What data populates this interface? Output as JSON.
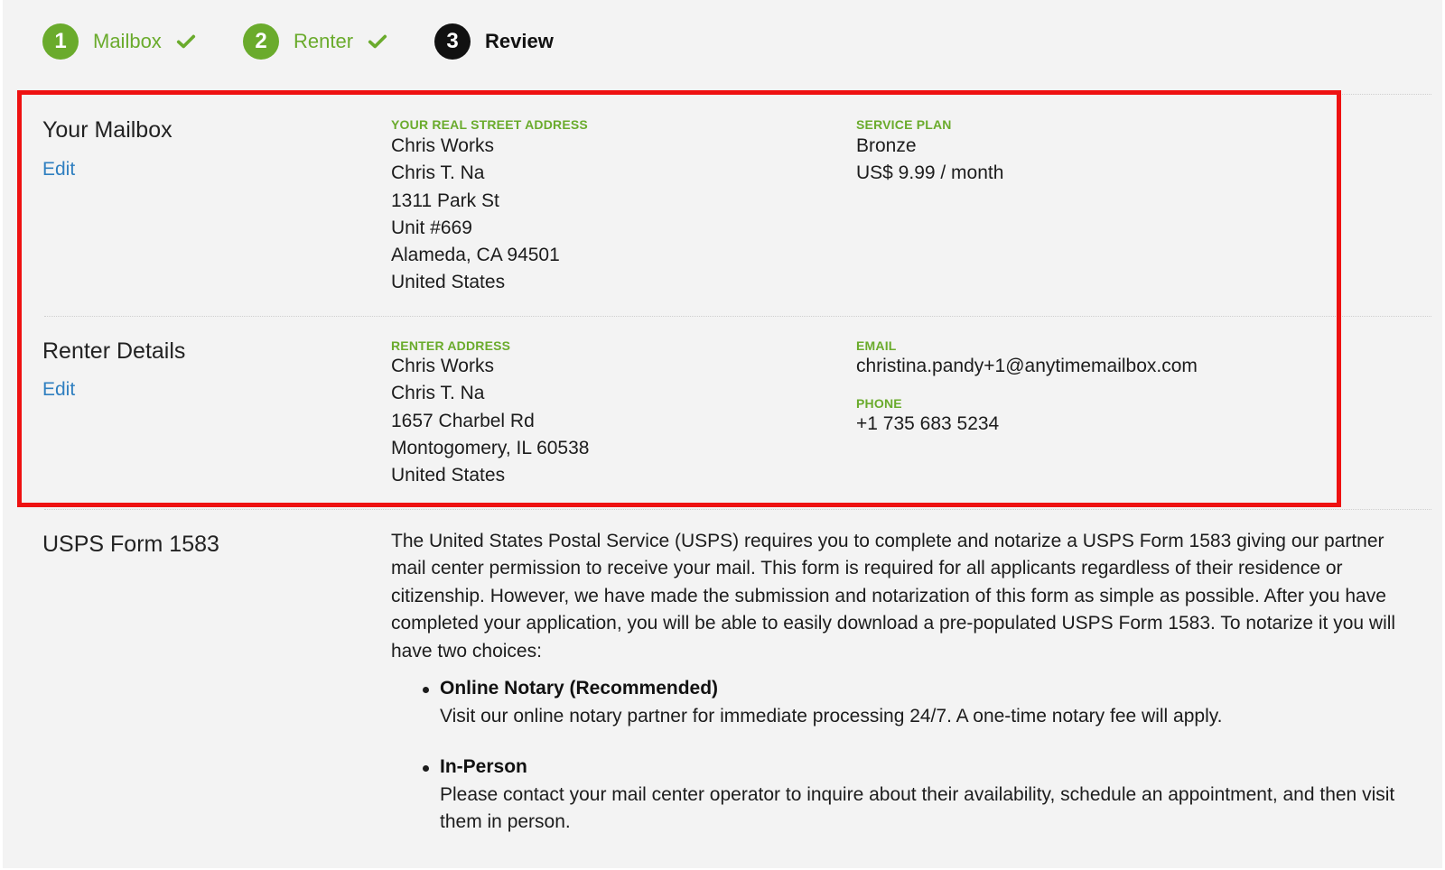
{
  "stepper": {
    "steps": [
      {
        "number": "1",
        "label": "Mailbox",
        "state": "done"
      },
      {
        "number": "2",
        "label": "Renter",
        "state": "done"
      },
      {
        "number": "3",
        "label": "Review",
        "state": "current"
      }
    ]
  },
  "mailbox": {
    "title": "Your Mailbox",
    "edit_label": "Edit",
    "address_label": "YOUR REAL STREET ADDRESS",
    "address_lines": [
      "Chris Works",
      "Chris T. Na",
      "1311 Park St",
      "Unit #669",
      "Alameda, CA 94501",
      "United States"
    ],
    "plan_label": "SERVICE PLAN",
    "plan_name": "Bronze",
    "plan_price": "US$ 9.99 / month"
  },
  "renter": {
    "title": "Renter Details",
    "edit_label": "Edit",
    "address_label": "RENTER ADDRESS",
    "address_lines": [
      "Chris Works",
      "Chris T. Na",
      "1657 Charbel Rd",
      "Montogomery, IL 60538",
      "United States"
    ],
    "email_label": "EMAIL",
    "email": "christina.pandy+1@anytimemailbox.com",
    "phone_label": "PHONE",
    "phone": "+1 735 683 5234"
  },
  "usps": {
    "title": "USPS Form 1583",
    "paragraph": "The United States Postal Service (USPS) requires you to complete and notarize a USPS Form 1583 giving our partner mail center permission to receive your mail. This form is required for all applicants regardless of their residence or citizenship. However, we have made the submission and notarization of this form as simple as possible. After you have completed your application, you will be able to easily download a pre-populated USPS Form 1583. To notarize it you will have two choices:",
    "options": [
      {
        "title": "Online Notary (Recommended)",
        "text": "Visit our online notary partner for immediate processing 24/7. A one-time notary fee will apply."
      },
      {
        "title": "In-Person",
        "text": "Please contact your mail center operator to inquire about their availability, schedule an appointment, and then visit them in person."
      }
    ]
  },
  "colors": {
    "accent_green": "#6aab2c",
    "link_blue": "#2f7fc0",
    "highlight_red": "#ee1111"
  }
}
